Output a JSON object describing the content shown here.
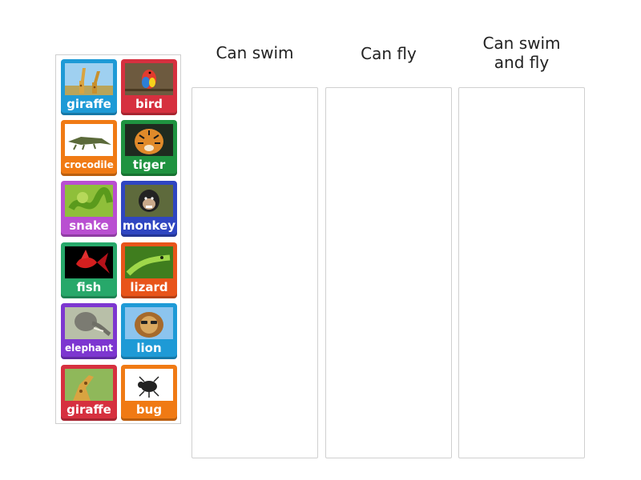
{
  "columns": [
    {
      "title": "Can swim"
    },
    {
      "title": "Can fly"
    },
    {
      "title_line1": "Can swim",
      "title_line2": "and fly"
    }
  ],
  "cards": [
    {
      "label": "giraffe",
      "color": "#1e9ad6"
    },
    {
      "label": "bird",
      "color": "#d6303f"
    },
    {
      "label": "crocodile",
      "color": "#f07a14"
    },
    {
      "label": "tiger",
      "color": "#1f9340"
    },
    {
      "label": "snake",
      "color": "#b94fd1"
    },
    {
      "label": "monkey",
      "color": "#2f46c1"
    },
    {
      "label": "fish",
      "color": "#27a86a"
    },
    {
      "label": "lizard",
      "color": "#e8541a"
    },
    {
      "label": "elephant",
      "color": "#7d36d0"
    },
    {
      "label": "lion",
      "color": "#1e9ad6"
    },
    {
      "label": "giraffe",
      "color": "#d6303f"
    },
    {
      "label": "bug",
      "color": "#f07a14"
    }
  ]
}
